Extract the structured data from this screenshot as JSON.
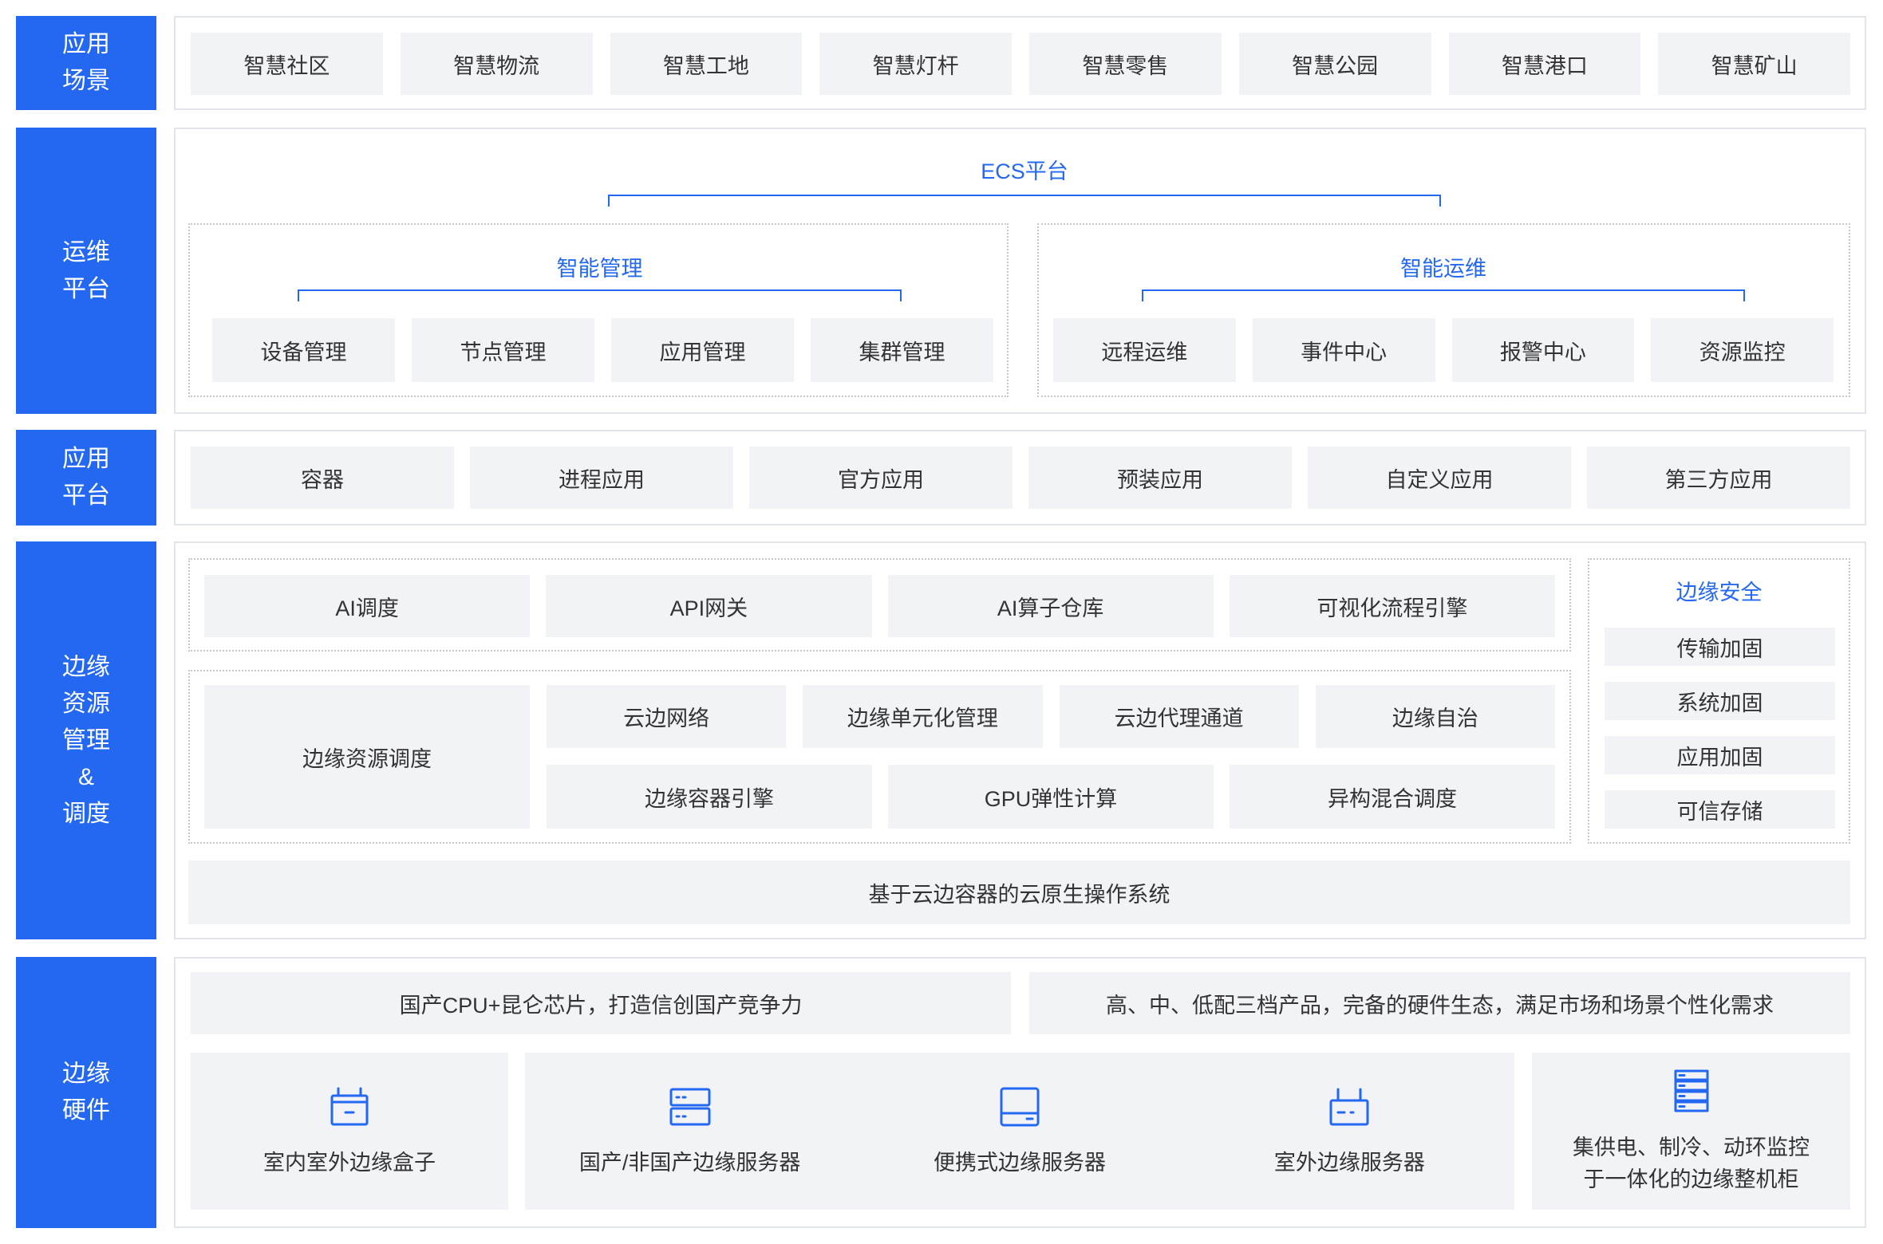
{
  "layers": {
    "scenes": {
      "label": "应用\n场景",
      "items": [
        "智慧社区",
        "智慧物流",
        "智慧工地",
        "智慧灯杆",
        "智慧零售",
        "智慧公园",
        "智慧港口",
        "智慧矿山"
      ]
    },
    "ops": {
      "label": "运维\n平台",
      "platform_title": "ECS平台",
      "management": {
        "title": "智能管理",
        "items": [
          "设备管理",
          "节点管理",
          "应用管理",
          "集群管理"
        ]
      },
      "maintenance": {
        "title": "智能运维",
        "items": [
          "远程运维",
          "事件中心",
          "报警中心",
          "资源监控"
        ]
      }
    },
    "apps": {
      "label": "应用\n平台",
      "items": [
        "容器",
        "进程应用",
        "官方应用",
        "预装应用",
        "自定义应用",
        "第三方应用"
      ]
    },
    "edge": {
      "label": "边缘\n资源\n管理\n&\n调度",
      "capabilities": [
        "AI调度",
        "API网关",
        "AI算子仓库",
        "可视化流程引擎"
      ],
      "scheduling": "边缘资源调度",
      "network_row": [
        "云边网络",
        "边缘单元化管理",
        "云边代理通道",
        "边缘自治"
      ],
      "compute_row": [
        "边缘容器引擎",
        "GPU弹性计算",
        "异构混合调度"
      ],
      "security": {
        "title": "边缘安全",
        "items": [
          "传输加固",
          "系统加固",
          "应用加固",
          "可信存储"
        ]
      },
      "os": "基于云边容器的云原生操作系统"
    },
    "hardware": {
      "label": "边缘\n硬件",
      "features": [
        "国产CPU+昆仑芯片，打造信创国产竞争力",
        "高、中、低配三档产品，完备的硬件生态，满足市场和场景个性化需求"
      ],
      "devices": [
        {
          "icon": "edge-box-icon",
          "label": "室内室外边缘盒子"
        },
        {
          "icon": "server-icon",
          "label": "国产/非国产边缘服务器"
        },
        {
          "icon": "portable-server-icon",
          "label": "便携式边缘服务器"
        },
        {
          "icon": "outdoor-server-icon",
          "label": "室外边缘服务器"
        },
        {
          "icon": "rack-cabinet-icon",
          "label": "集供电、制冷、动环监控\n于一体化的边缘整机柜"
        }
      ]
    }
  },
  "colors": {
    "accent": "#2468f2",
    "box": "#f1f3f6",
    "panel_border": "#e2e5ea",
    "dotted_border": "#c5c9cf",
    "text": "#333333",
    "label_text": "#ffffff"
  }
}
